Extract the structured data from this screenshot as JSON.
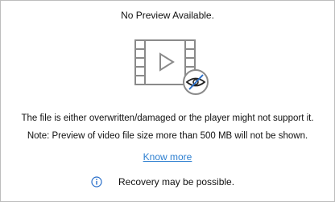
{
  "preview": {
    "title": "No Preview Available.",
    "message_line1": "The file is either overwritten/damaged or the player might not support it.",
    "message_line2": "Note: Preview of video file size more than 500 MB will not be shown.",
    "link_label": "Know more",
    "recovery_text": "Recovery may be possible."
  },
  "icons": {
    "main": "video-file-no-preview-icon",
    "overlay": "eye-slash-icon",
    "info": "info-icon"
  },
  "colors": {
    "icon_gray": "#8a8a8a",
    "link_blue": "#2d7fd0",
    "info_blue": "#2a6fc9",
    "text": "#111111",
    "border": "#bdbdbd"
  }
}
